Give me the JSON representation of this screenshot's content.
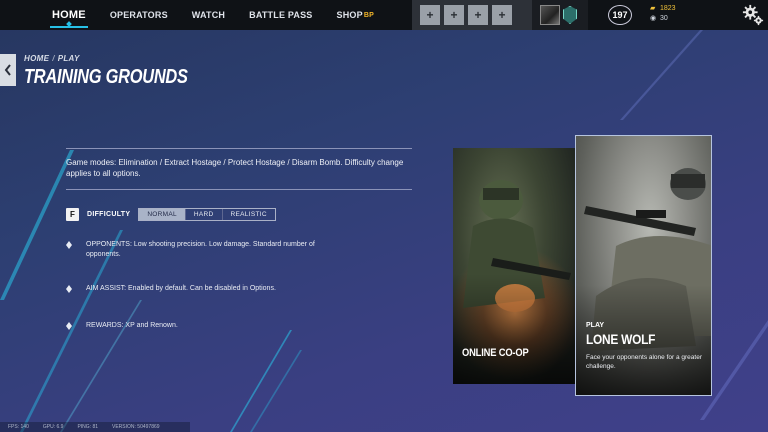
{
  "nav": {
    "items": [
      {
        "label": "HOME"
      },
      {
        "label": "OPERATORS"
      },
      {
        "label": "WATCH"
      },
      {
        "label": "BATTLE PASS"
      },
      {
        "label": "SHOP"
      }
    ],
    "shop_badge": "BP"
  },
  "squad": {
    "slots": [
      "+",
      "+",
      "+",
      "+"
    ]
  },
  "profile": {
    "level": "197"
  },
  "currency": {
    "renown": "1823",
    "credits": "30"
  },
  "breadcrumb": {
    "home": "HOME",
    "sep": "/",
    "current": "PLAY"
  },
  "page": {
    "title": "TRAINING GROUNDS"
  },
  "description": "Game modes: Elimination / Extract Hostage / Protect Hostage / Disarm Bomb. Difficulty change applies to all options.",
  "difficulty": {
    "key": "F",
    "label": "DIFFICULTY",
    "options": [
      "NORMAL",
      "HARD",
      "REALISTIC"
    ],
    "selected": "NORMAL"
  },
  "info": [
    {
      "text": "OPPONENTS: Low shooting precision. Low damage. Standard number of opponents."
    },
    {
      "text": "AIM ASSIST: Enabled by default. Can be disabled in Options."
    },
    {
      "text": "REWARDS: XP and Renown."
    }
  ],
  "cards": {
    "coop": {
      "name": "ONLINE CO-OP"
    },
    "lone": {
      "kicker": "PLAY",
      "name": "LONE WOLF",
      "desc": "Face your opponents alone for a greater challenge."
    }
  },
  "footer": {
    "fps": "FPS: 140",
    "gpu": "GPU: 6.9",
    "ping": "PING: 81",
    "version": "VERSION: 50497869"
  },
  "colors": {
    "accent": "#27c0e6",
    "gold": "#f0c23a"
  }
}
